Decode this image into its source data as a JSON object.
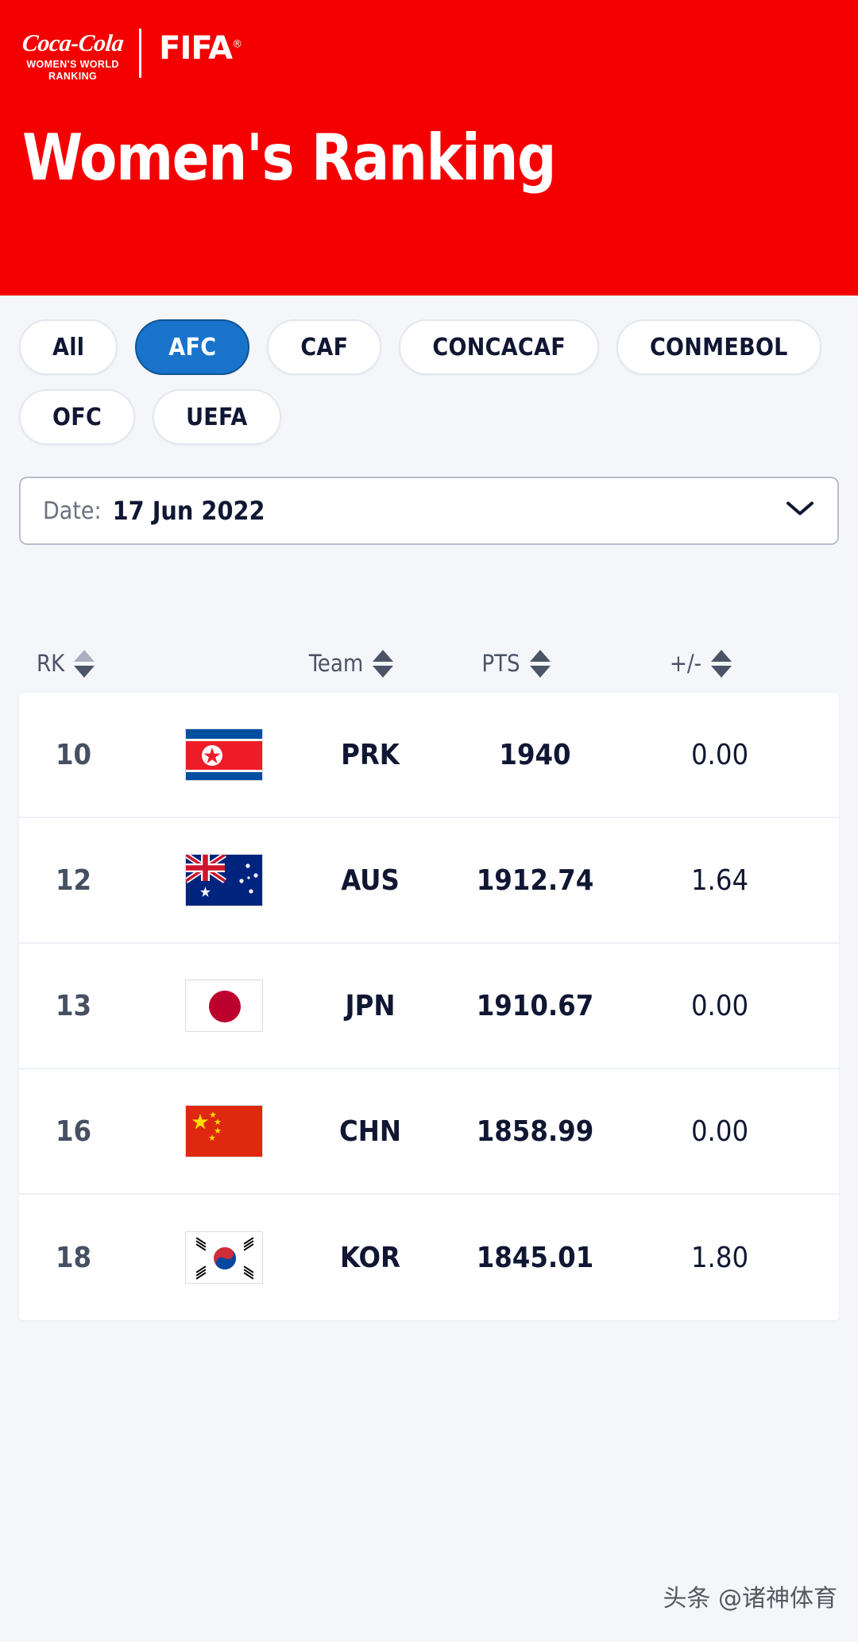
{
  "header": {
    "brand_script": "Coca-Cola",
    "brand_line1": "WOMEN'S WORLD",
    "brand_line2": "RANKING",
    "fifa": "FIFA",
    "title": "Women's Ranking",
    "bg_color": "#f40000"
  },
  "filters": {
    "items": [
      {
        "label": "All",
        "active": false
      },
      {
        "label": "AFC",
        "active": true
      },
      {
        "label": "CAF",
        "active": false
      },
      {
        "label": "CONCACAF",
        "active": false
      },
      {
        "label": "CONMEBOL",
        "active": false
      },
      {
        "label": "OFC",
        "active": false
      },
      {
        "label": "UEFA",
        "active": false
      }
    ],
    "active_color": "#1a73cb"
  },
  "date_select": {
    "label": "Date:",
    "value": "17 Jun 2022",
    "chevron": "chevron-down-icon"
  },
  "table": {
    "columns": [
      {
        "key": "rk",
        "label": "RK"
      },
      {
        "key": "flag",
        "label": ""
      },
      {
        "key": "team",
        "label": "Team"
      },
      {
        "key": "pts",
        "label": "PTS"
      },
      {
        "key": "pm",
        "label": "+/-"
      }
    ],
    "rows": [
      {
        "rk": "10",
        "team": "PRK",
        "pts": "1940",
        "pm": "0.00",
        "flag": "flag-prk"
      },
      {
        "rk": "12",
        "team": "AUS",
        "pts": "1912.74",
        "pm": "1.64",
        "flag": "flag-aus"
      },
      {
        "rk": "13",
        "team": "JPN",
        "pts": "1910.67",
        "pm": "0.00",
        "flag": "flag-jpn"
      },
      {
        "rk": "16",
        "team": "CHN",
        "pts": "1858.99",
        "pm": "0.00",
        "flag": "flag-chn"
      },
      {
        "rk": "18",
        "team": "KOR",
        "pts": "1845.01",
        "pm": "1.80",
        "flag": "flag-kor"
      }
    ]
  },
  "watermark": {
    "text": "头条 @诸神体育"
  }
}
